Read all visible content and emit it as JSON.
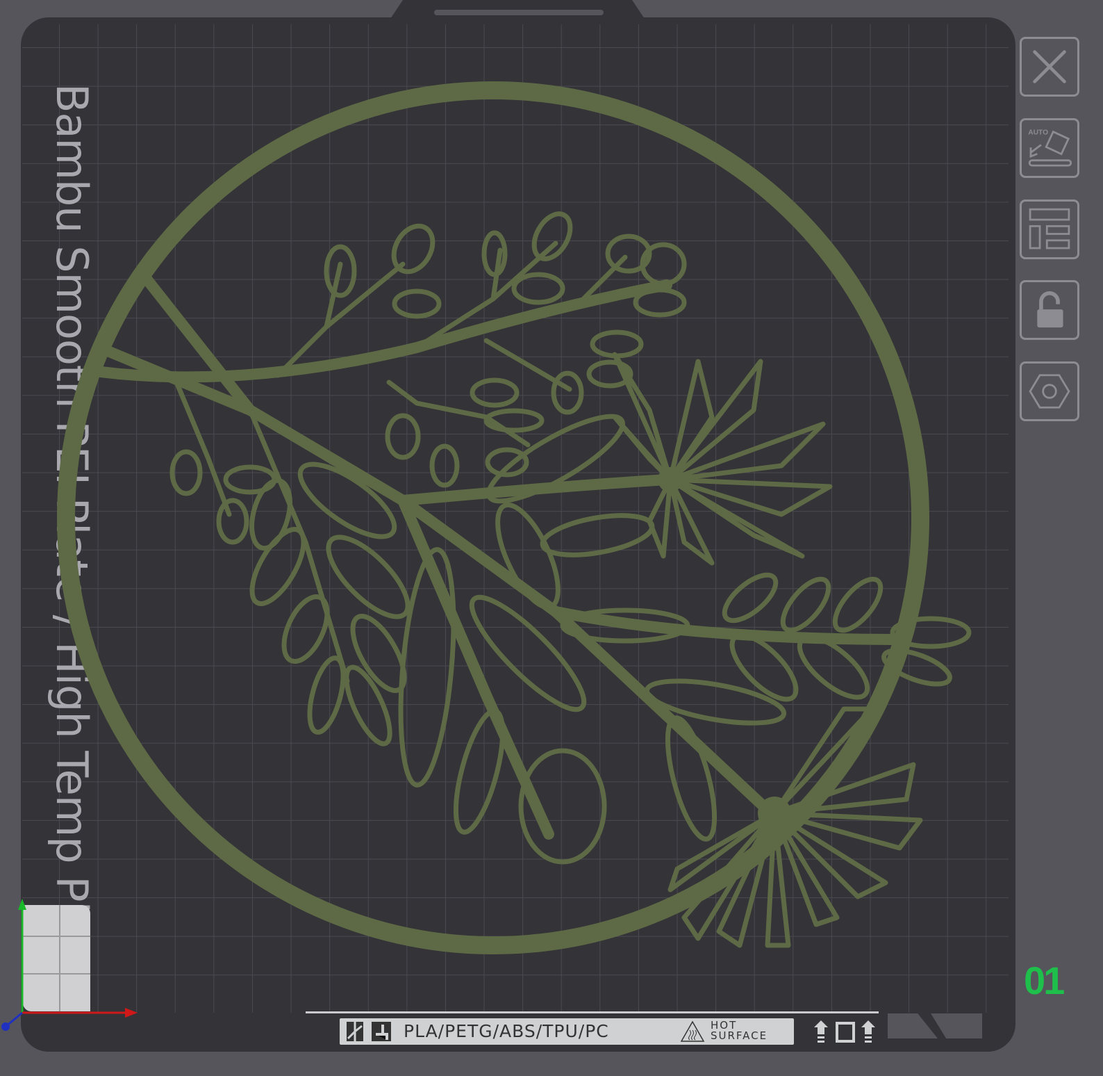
{
  "plate": {
    "name": "Bambu Smooth PEI Plate / High Temp Plate",
    "number": "01",
    "material_label": "PLA/PETG/ABS/TPU/PC",
    "warning_line1": "HOT",
    "warning_line2": "SURFACE"
  },
  "toolbar": {
    "items": [
      {
        "icon": "close-icon"
      },
      {
        "icon": "auto-orient-icon",
        "label": "AUTO"
      },
      {
        "icon": "arrange-icon"
      },
      {
        "icon": "unlock-icon"
      },
      {
        "icon": "plate-settings-icon"
      }
    ]
  },
  "colors": {
    "model": "#5e6a45",
    "plate": "#333338",
    "accent": "#1fbf4c"
  }
}
